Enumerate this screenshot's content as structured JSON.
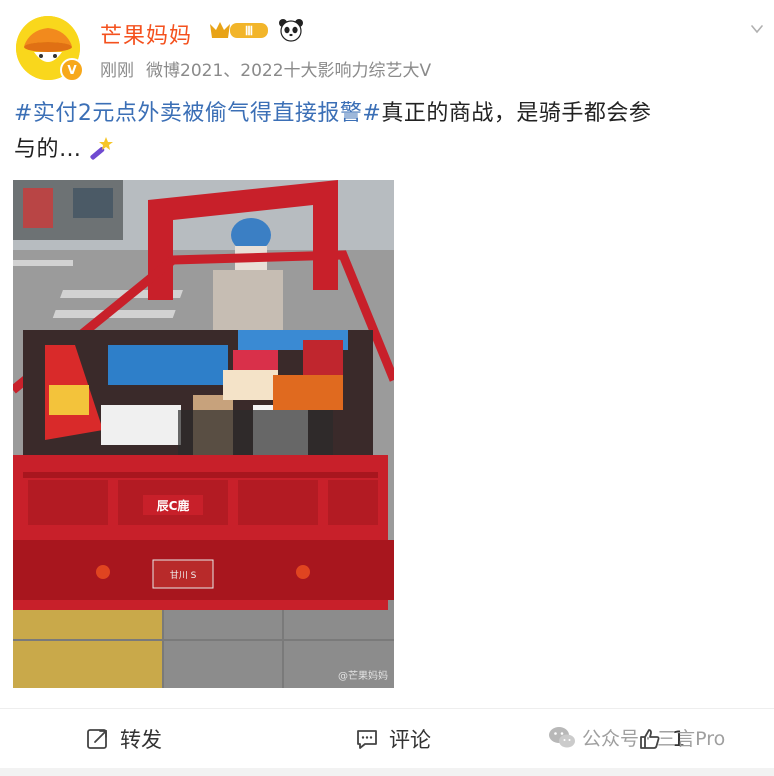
{
  "post": {
    "author_name": "芒果妈妈",
    "rank_badge": "Ⅲ",
    "verified_badge": "V",
    "time": "刚刚",
    "source": "微博2021、2022十大影响力综艺大V",
    "hashtag": "#实付2元点外卖被偷气得直接报警#",
    "body_line1": "真正的商战，是骑手都会参",
    "body_line2": "与的…",
    "image_watermark": "@芒果妈妈"
  },
  "photo": {
    "brand_text": "辰C鹿",
    "plate_text": "甘川 S"
  },
  "actions": {
    "repost_label": "转发",
    "comment_label": "评论",
    "like_count": "1"
  },
  "overlay": {
    "wechat_watermark": "公众号 · 三言Pro"
  },
  "colors": {
    "name_orange": "#f4511e",
    "hashtag_blue": "#3b6fb6",
    "meta_gray": "#8a8a8a",
    "vehicle_red": "#c8202a"
  },
  "icons": [
    "chevron-down-icon",
    "avatar-icon",
    "verified-v-icon",
    "rank-badge-icon",
    "panda-icon",
    "wand-emoji-icon",
    "repost-icon",
    "comment-icon",
    "like-icon",
    "wechat-icon"
  ]
}
